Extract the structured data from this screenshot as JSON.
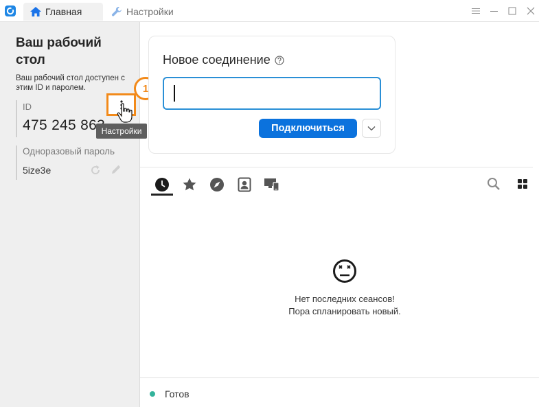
{
  "titlebar": {
    "tabs": [
      {
        "label": "Главная",
        "icon": "home-icon",
        "active": true
      },
      {
        "label": "Настройки",
        "icon": "wrench-icon",
        "active": false
      }
    ],
    "controls": [
      "menu-icon",
      "minimize-icon",
      "maximize-icon",
      "close-icon"
    ]
  },
  "left_panel": {
    "title": "Ваш рабочий стол",
    "description": "Ваш рабочий стол доступен с этим ID и паролем.",
    "id_label": "ID",
    "id_value": "475 245 863",
    "password_label": "Одноразовый пароль",
    "password_value": "5ize3e"
  },
  "annotation": {
    "badge_number": "1",
    "tooltip": "Настройки"
  },
  "connect": {
    "title": "Новое соединение",
    "input_value": "",
    "connect_label": "Подключиться"
  },
  "session_tabs": [
    "recent-sessions-icon",
    "favorites-icon",
    "discovered-icon",
    "address-book-icon",
    "group-devices-icon"
  ],
  "empty_state": {
    "line1": "Нет последних сеансов!",
    "line2": "Пора спланировать новый."
  },
  "status": {
    "text": "Готов",
    "color": "#33b39b"
  },
  "colors": {
    "accent": "#0b72dd",
    "annotation": "#f28a1a"
  }
}
